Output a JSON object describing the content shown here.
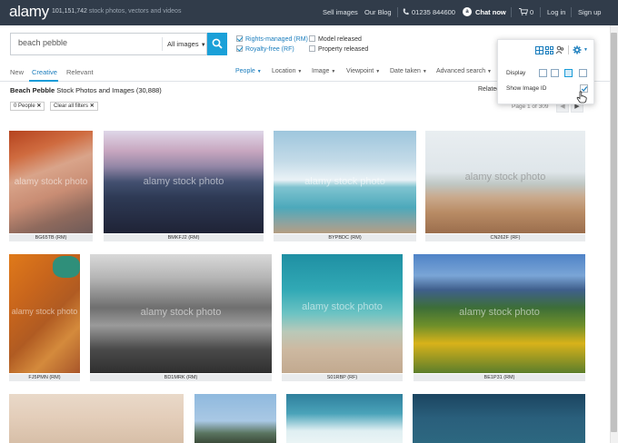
{
  "header": {
    "logo": "alamy",
    "tagline_count": "101,151,742",
    "tagline_text": "stock photos, vectors and videos",
    "nav": {
      "sell": "Sell images",
      "blog": "Our Blog",
      "phone": "01235 844600",
      "chat": "Chat now",
      "cart_count": "0",
      "login": "Log in",
      "signup": "Sign up"
    }
  },
  "search": {
    "query": "beach pebble",
    "type": "All images",
    "options": {
      "rm": "Rights-managed (RM)",
      "rf": "Royalty-free (RF)",
      "model": "Model released",
      "property": "Property released"
    }
  },
  "tabs": [
    "New",
    "Creative",
    "Relevant"
  ],
  "filters": [
    "People",
    "Location",
    "Image",
    "Viewpoint",
    "Date taken",
    "Advanced search"
  ],
  "results": {
    "title": "Beach Pebble",
    "subtitle": "Stock Photos and Images",
    "count": "(30,888)",
    "related": "Related",
    "page": "Page 1 of 309"
  },
  "active_filters": {
    "people": "0 People",
    "clear": "Clear all filters"
  },
  "watermark": "alamy stock photo",
  "images": [
    {
      "id": "BG65TB",
      "lic": "(RM)"
    },
    {
      "id": "BMKFJ2",
      "lic": "(RM)"
    },
    {
      "id": "BYPBDC",
      "lic": "(RM)"
    },
    {
      "id": "CN262F",
      "lic": "(RF)"
    },
    {
      "id": "FJ5PMN",
      "lic": "(RM)"
    },
    {
      "id": "BD1MRK",
      "lic": "(RM)"
    },
    {
      "id": "S01RBP",
      "lic": "(RF)"
    },
    {
      "id": "BE1P31",
      "lic": "(RM)"
    }
  ],
  "dropdown": {
    "display": "Display",
    "show_id": "Show Image ID"
  },
  "colors": {
    "topbar": "#313c4a",
    "accent": "#1aa0d8",
    "link": "#1a7dbd"
  }
}
